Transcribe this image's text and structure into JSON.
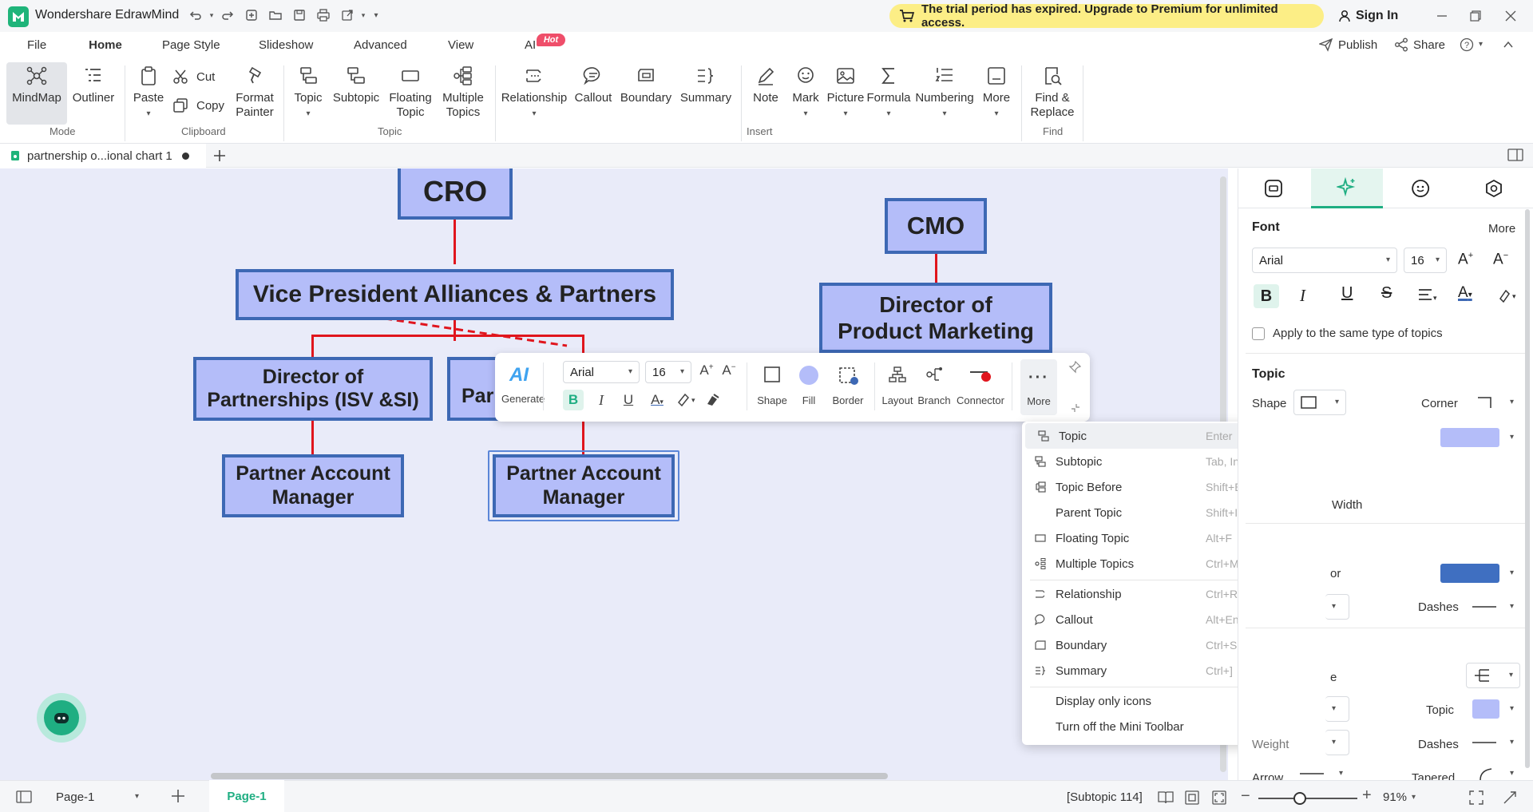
{
  "app": {
    "title": "Wondershare EdrawMind",
    "brand_color": "#1fb47a"
  },
  "trial": {
    "text": "The trial period has expired. Upgrade to Premium for unlimited access."
  },
  "account": {
    "signin": "Sign In"
  },
  "menu": {
    "file": "File",
    "home": "Home",
    "page_style": "Page Style",
    "slideshow": "Slideshow",
    "advanced": "Advanced",
    "view": "View",
    "ai": "AI",
    "hot_badge": "Hot",
    "publish": "Publish",
    "share": "Share"
  },
  "ribbon": {
    "mode": {
      "mindmap": "MindMap",
      "outliner": "Outliner",
      "group": "Mode"
    },
    "clipboard": {
      "paste": "Paste",
      "cut": "Cut",
      "copy": "Copy",
      "format_painter_1": "Format",
      "format_painter_2": "Painter",
      "group": "Clipboard"
    },
    "topic": {
      "topic": "Topic",
      "subtopic": "Subtopic",
      "floating_1": "Floating",
      "floating_2": "Topic",
      "multiple_1": "Multiple",
      "multiple_2": "Topics",
      "group": "Topic"
    },
    "insert": {
      "relationship": "Relationship",
      "callout": "Callout",
      "boundary": "Boundary",
      "summary": "Summary",
      "note": "Note",
      "mark": "Mark",
      "picture": "Picture",
      "formula": "Formula",
      "numbering": "Numbering",
      "more": "More",
      "group": "Insert"
    },
    "find": {
      "label_1": "Find &",
      "label_2": "Replace",
      "group": "Find"
    }
  },
  "document": {
    "tab_name": "partnership o...ional chart 1"
  },
  "mindmap": {
    "cro": "CRO",
    "vp": "Vice President Alliances & Partners",
    "dir_partnerships_1": "Director of",
    "dir_partnerships_2": "Partnerships (ISV &SI)",
    "partial_node": "Par",
    "pam1_1": "Partner Account",
    "pam1_2": "Manager",
    "pam2_1": "Partner Account",
    "pam2_2": "Manager",
    "cmo": "CMO",
    "dir_pm_1": "Director of",
    "dir_pm_2": "Product Marketing",
    "node_fill": "#b4bdf9",
    "node_border": "#3d68b4",
    "line_color": "#e0151d"
  },
  "mini_toolbar": {
    "ai": "AI",
    "generate": "Generate",
    "font": "Arial",
    "size": "16",
    "shape": "Shape",
    "fill": "Fill",
    "border": "Border",
    "layout": "Layout",
    "branch": "Branch",
    "connector": "Connector",
    "more": "More"
  },
  "context_menu": [
    {
      "label": "Topic",
      "shortcut": "Enter",
      "icon": "topic-icon"
    },
    {
      "label": "Subtopic",
      "shortcut": "Tab, Ins, Ctrl+Enter",
      "icon": "subtopic-icon"
    },
    {
      "label": "Topic Before",
      "shortcut": "Shift+Enter",
      "icon": "topic-before-icon"
    },
    {
      "label": "Parent Topic",
      "shortcut": "Shift+Ins",
      "icon": ""
    },
    {
      "label": "Floating Topic",
      "shortcut": "Alt+F",
      "icon": "floating-topic-icon"
    },
    {
      "label": "Multiple Topics",
      "shortcut": "Ctrl+M",
      "icon": "multiple-topics-icon"
    },
    {
      "label": "Relationship",
      "shortcut": "Ctrl+R",
      "icon": "relationship-icon"
    },
    {
      "label": "Callout",
      "shortcut": "Alt+Enter",
      "icon": "callout-icon"
    },
    {
      "label": "Boundary",
      "shortcut": "Ctrl+Shift+B",
      "icon": "boundary-icon"
    },
    {
      "label": "Summary",
      "shortcut": "Ctrl+]",
      "icon": "summary-icon"
    },
    {
      "label": "Display only icons",
      "shortcut": "",
      "icon": ""
    },
    {
      "label": "Turn off the Mini Toolbar",
      "shortcut": "",
      "icon": ""
    }
  ],
  "panel": {
    "font_title": "Font",
    "more": "More",
    "font": "Arial",
    "size": "16",
    "apply_same": "Apply to the same type of topics",
    "topic_title": "Topic",
    "shape": "Shape",
    "corner": "Corner",
    "width_partial": "Width",
    "or_partial": "or",
    "dashes": "Dashes",
    "e_partial": "e",
    "topic_label": "Topic",
    "weight": "Weight",
    "dashes2": "Dashes",
    "arrow": "Arrow",
    "tapered": "Tapered",
    "fill_color": "#b4bdf9",
    "line_color": "#3f6fc1"
  },
  "status": {
    "page_select": "Page-1",
    "page_tab": "Page-1",
    "selection": "[Subtopic 114]",
    "zoom": "91%",
    "zoom_level": 0.42
  }
}
